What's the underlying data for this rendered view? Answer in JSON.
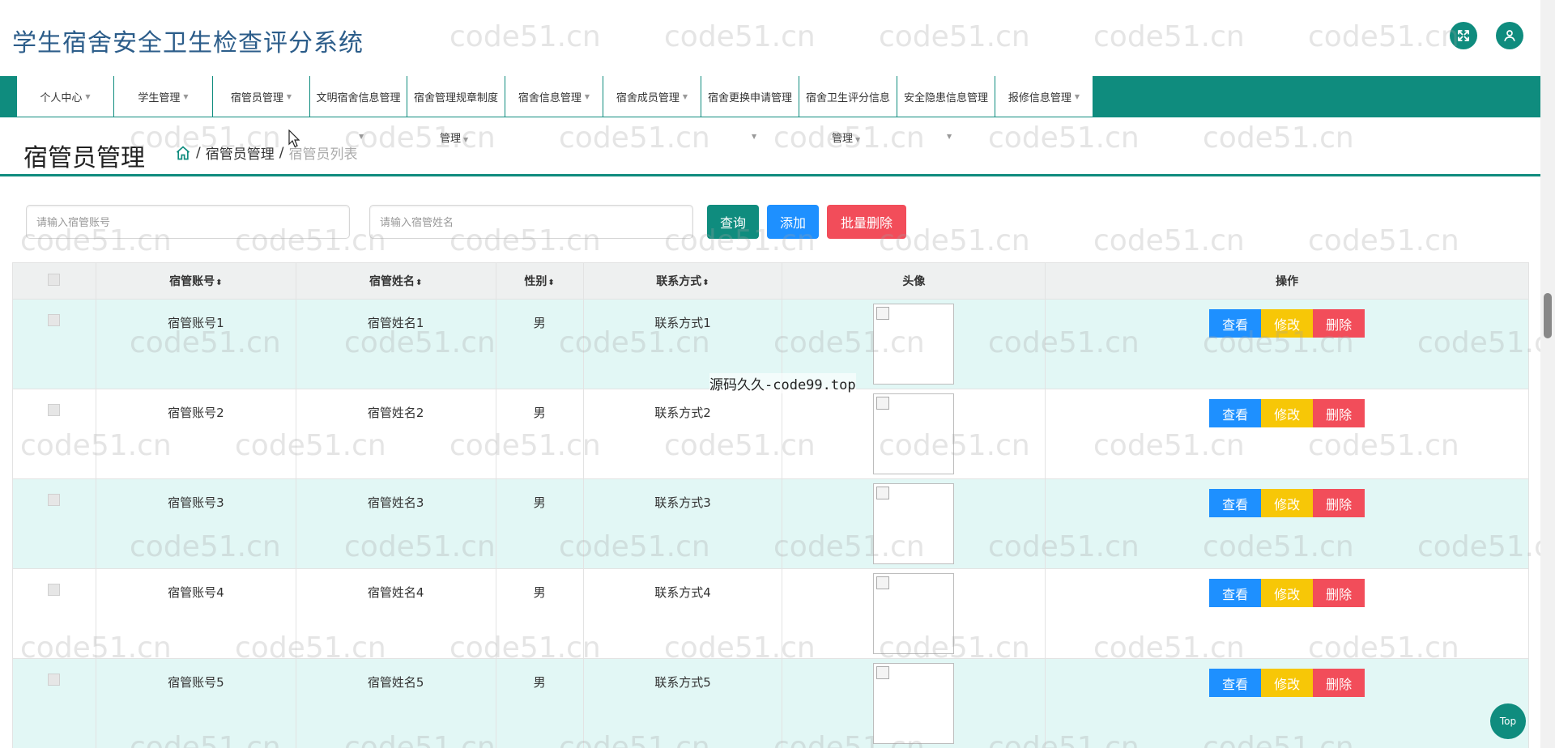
{
  "header": {
    "title": "学生宿舍安全卫生检查评分系统"
  },
  "nav": {
    "items": [
      {
        "label": "个人中心",
        "has_caret": true
      },
      {
        "label": "学生管理",
        "has_caret": true
      },
      {
        "label": "宿管员管理",
        "has_caret": true
      },
      {
        "label": "文明宿舍信息管理",
        "has_caret": false
      },
      {
        "label": "宿舍管理规章制度",
        "has_caret": false
      },
      {
        "label": "宿舍信息管理",
        "has_caret": true
      },
      {
        "label": "宿舍成员管理",
        "has_caret": true
      },
      {
        "label": "宿舍更换申请管理",
        "has_caret": false
      },
      {
        "label": "宿舍卫生评分信息",
        "has_caret": false
      },
      {
        "label": "安全隐患信息管理",
        "has_caret": false
      },
      {
        "label": "报修信息管理",
        "has_caret": true
      }
    ],
    "overflow_labels": [
      "管理",
      "管理"
    ]
  },
  "page": {
    "title": "宿管员管理",
    "breadcrumb": [
      "宿管员管理",
      "宿管员列表"
    ]
  },
  "search": {
    "account_placeholder": "请输入宿管账号",
    "name_placeholder": "请输入宿管姓名",
    "query_label": "查询",
    "add_label": "添加",
    "batch_delete_label": "批量删除"
  },
  "table": {
    "columns": [
      "宿管账号",
      "宿管姓名",
      "性别",
      "联系方式",
      "头像",
      "操作"
    ],
    "rows": [
      {
        "account": "宿管账号1",
        "name": "宿管姓名1",
        "gender": "男",
        "contact": "联系方式1"
      },
      {
        "account": "宿管账号2",
        "name": "宿管姓名2",
        "gender": "男",
        "contact": "联系方式2"
      },
      {
        "account": "宿管账号3",
        "name": "宿管姓名3",
        "gender": "男",
        "contact": "联系方式3"
      },
      {
        "account": "宿管账号4",
        "name": "宿管姓名4",
        "gender": "男",
        "contact": "联系方式4"
      },
      {
        "account": "宿管账号5",
        "name": "宿管姓名5",
        "gender": "男",
        "contact": "联系方式5"
      }
    ],
    "actions": {
      "view": "查看",
      "edit": "修改",
      "delete": "删除"
    }
  },
  "watermark": {
    "text": "code51.cn",
    "center_text": "源码久久-code99.top"
  },
  "back_to_top": "Top",
  "colors": {
    "primary": "#0f8c7e",
    "info": "#1e90ff",
    "warning": "#f7c707",
    "danger": "#f24d5a",
    "row_alt": "#e2f7f5"
  },
  "icons": [
    "fullscreen-icon",
    "user-icon",
    "home-icon"
  ]
}
